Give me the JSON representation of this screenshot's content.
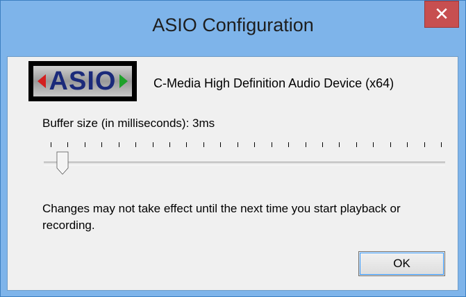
{
  "window": {
    "title": "ASIO Configuration",
    "close_glyph": "✕"
  },
  "logo": {
    "text": "ASIO",
    "colors": {
      "left_arrow": "#d32020",
      "right_arrow": "#1ea12a",
      "text": "#1b2a7a"
    }
  },
  "device": {
    "name": "C-Media High Definition Audio Device (x64)"
  },
  "buffer": {
    "label": "Buffer size (in milliseconds): 3ms",
    "slider_value": 3
  },
  "note": {
    "text": "Changes may not take effect until the next time you start playback or recording."
  },
  "buttons": {
    "ok_label": "OK"
  },
  "colors": {
    "title_bar": "#7eb4ea",
    "close_button": "#c74f50",
    "client_bg": "#f0f0f0"
  },
  "icons": [
    "close-icon",
    "asio-logo",
    "slider-thumb"
  ]
}
